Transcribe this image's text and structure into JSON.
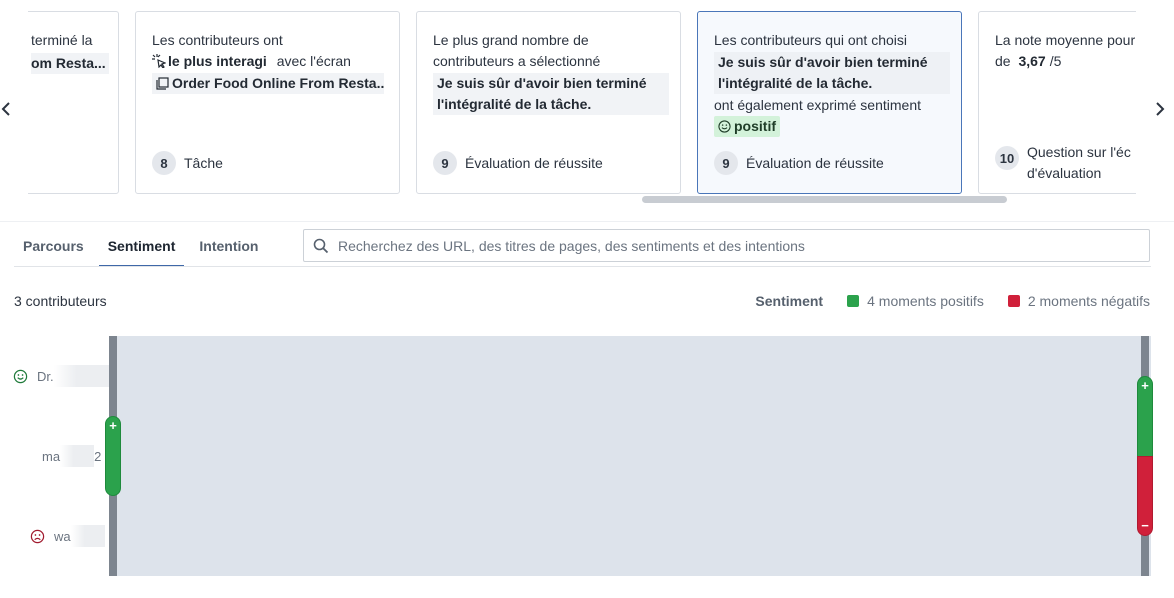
{
  "carousel": {
    "cards": [
      {
        "text_prefix": "terminé la",
        "pill": "om Resta...",
        "footer": ""
      },
      {
        "line1": "Les contributeurs ont",
        "pill1": "le plus interagi",
        "mid": "avec l'écran",
        "pill2": "Order Food Online From Resta...",
        "icon1": "magic-cursor-icon",
        "icon2": "screen-icon",
        "count": "8",
        "footer": "Tâche"
      },
      {
        "text": "Le plus grand nombre de contributeurs a sélectionné",
        "pill": "Je suis sûr d'avoir bien terminé l'intégralité de la tâche.",
        "count": "9",
        "footer": "Évaluation de réussite"
      },
      {
        "line1": "Les contributeurs qui ont choisi",
        "pill": "Je suis sûr d'avoir bien terminé l'intégralité de la tâche.",
        "line2": "ont également exprimé sentiment",
        "sentiment": "positif",
        "sentiment_icon": "smile-icon",
        "count": "9",
        "footer": "Évaluation de réussite"
      },
      {
        "line1": "La note moyenne pour",
        "de": "de",
        "value": "3,67",
        "suffix": "/5",
        "count": "10",
        "footer_line1": "Question sur l'éc",
        "footer_line2": "d'évaluation"
      }
    ],
    "prev_icon": "chevron-left-icon",
    "next_icon": "chevron-right-icon"
  },
  "tabs": [
    {
      "label": "Parcours"
    },
    {
      "label": "Sentiment",
      "active": true
    },
    {
      "label": "Intention"
    }
  ],
  "search": {
    "placeholder": "Recherchez des URL, des titres de pages, des sentiments et des intentions",
    "icon": "search-icon"
  },
  "summary": {
    "contributors": "3 contributeurs",
    "legend_title": "Sentiment",
    "positive": "4 moments positifs",
    "negative": "2 moments négatifs",
    "positive_color": "#2ba24c",
    "negative_color": "#d0203a"
  },
  "timeline": {
    "rows": [
      {
        "name": "Dr.",
        "icon": "smile-icon"
      },
      {
        "name": "ma",
        "suffix": "2",
        "icon": ""
      },
      {
        "name": "wa",
        "icon": "frown-icon"
      }
    ]
  }
}
